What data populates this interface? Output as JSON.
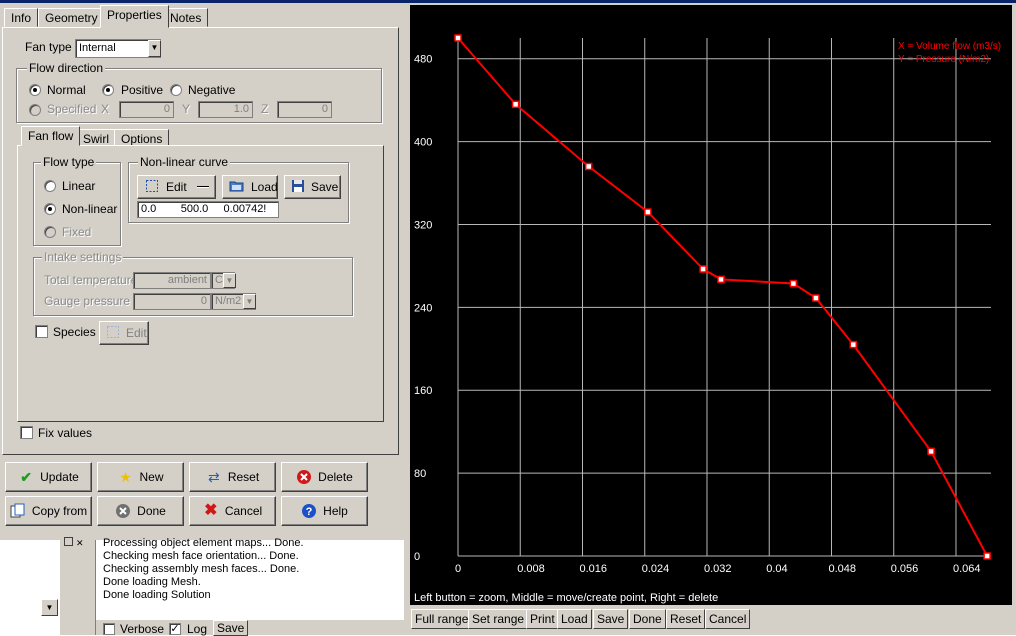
{
  "tabs": [
    "Info",
    "Geometry",
    "Properties",
    "Notes"
  ],
  "fan_type": {
    "label": "Fan type",
    "value": "Internal"
  },
  "flow_direction": {
    "title": "Flow direction",
    "options": [
      "Normal",
      "Positive",
      "Negative",
      "Specified"
    ],
    "x_label": "X",
    "x_value": "0",
    "y_label": "Y",
    "y_value": "1.0",
    "z_label": "Z",
    "z_value": "0"
  },
  "subtabs": [
    "Fan flow",
    "Swirl",
    "Options"
  ],
  "flow_type": {
    "title": "Flow type",
    "options": [
      "Linear",
      "Non-linear",
      "Fixed"
    ],
    "selected": "Non-linear"
  },
  "nonlinear_curve": {
    "title": "Non-linear curve",
    "edit_label": "Edit",
    "load_label": "Load",
    "save_label": "Save",
    "values": "0.0        500.0     0.00742!"
  },
  "intake": {
    "title": "Intake settings",
    "temp_label": "Total temperature",
    "temp_value": "ambient",
    "temp_unit": "C",
    "pressure_label": "Gauge pressure",
    "pressure_value": "0",
    "pressure_unit": "N/m2"
  },
  "species": {
    "label": "Species",
    "edit_label": "Edit"
  },
  "fix_values_label": "Fix values",
  "buttons": {
    "update": "Update",
    "new": "New",
    "reset": "Reset",
    "delete": "Delete",
    "copy_from": "Copy from",
    "done": "Done",
    "cancel": "Cancel",
    "help": "Help"
  },
  "log": {
    "lines": [
      "Processing object element maps... Done.",
      "Checking mesh face orientation... Done.",
      "Checking assembly mesh faces... Done.",
      "Done loading Mesh.",
      "Done loading Solution"
    ],
    "verbose_label": "Verbose",
    "log_label": "Log",
    "save_label": "Save"
  },
  "chart_data": {
    "type": "line",
    "xlabel": "X = Volume flow (m3/s)",
    "ylabel": "Y = Pressure (N/m2)",
    "xlim": [
      0,
      0.0685
    ],
    "ylim": [
      0,
      500
    ],
    "x_ticks": [
      "0",
      "0.008",
      "0.016",
      "0.024",
      "0.032",
      "0.04",
      "0.048",
      "0.056",
      "0.064"
    ],
    "y_ticks": [
      "0",
      "80",
      "160",
      "240",
      "320",
      "400",
      "480"
    ],
    "x_tick_values": [
      0,
      0.008,
      0.016,
      0.024,
      0.032,
      0.04,
      0.048,
      0.056,
      0.064
    ],
    "y_tick_values": [
      0,
      80,
      160,
      240,
      320,
      400,
      480
    ],
    "grid": true,
    "color": "#ff0000",
    "points": [
      {
        "x": 0.0,
        "y": 500
      },
      {
        "x": 0.0074,
        "y": 436
      },
      {
        "x": 0.0168,
        "y": 376
      },
      {
        "x": 0.0244,
        "y": 332
      },
      {
        "x": 0.0315,
        "y": 277
      },
      {
        "x": 0.0338,
        "y": 267
      },
      {
        "x": 0.0431,
        "y": 263
      },
      {
        "x": 0.046,
        "y": 249
      },
      {
        "x": 0.0508,
        "y": 204
      },
      {
        "x": 0.0608,
        "y": 101
      },
      {
        "x": 0.068,
        "y": 0
      }
    ]
  },
  "plot_help": "Left button = zoom, Middle = move/create point, Right = delete",
  "plot_buttons": [
    "Full range",
    "Set range",
    "Print",
    "Load",
    "Save",
    "Done",
    "Reset",
    "Cancel"
  ]
}
